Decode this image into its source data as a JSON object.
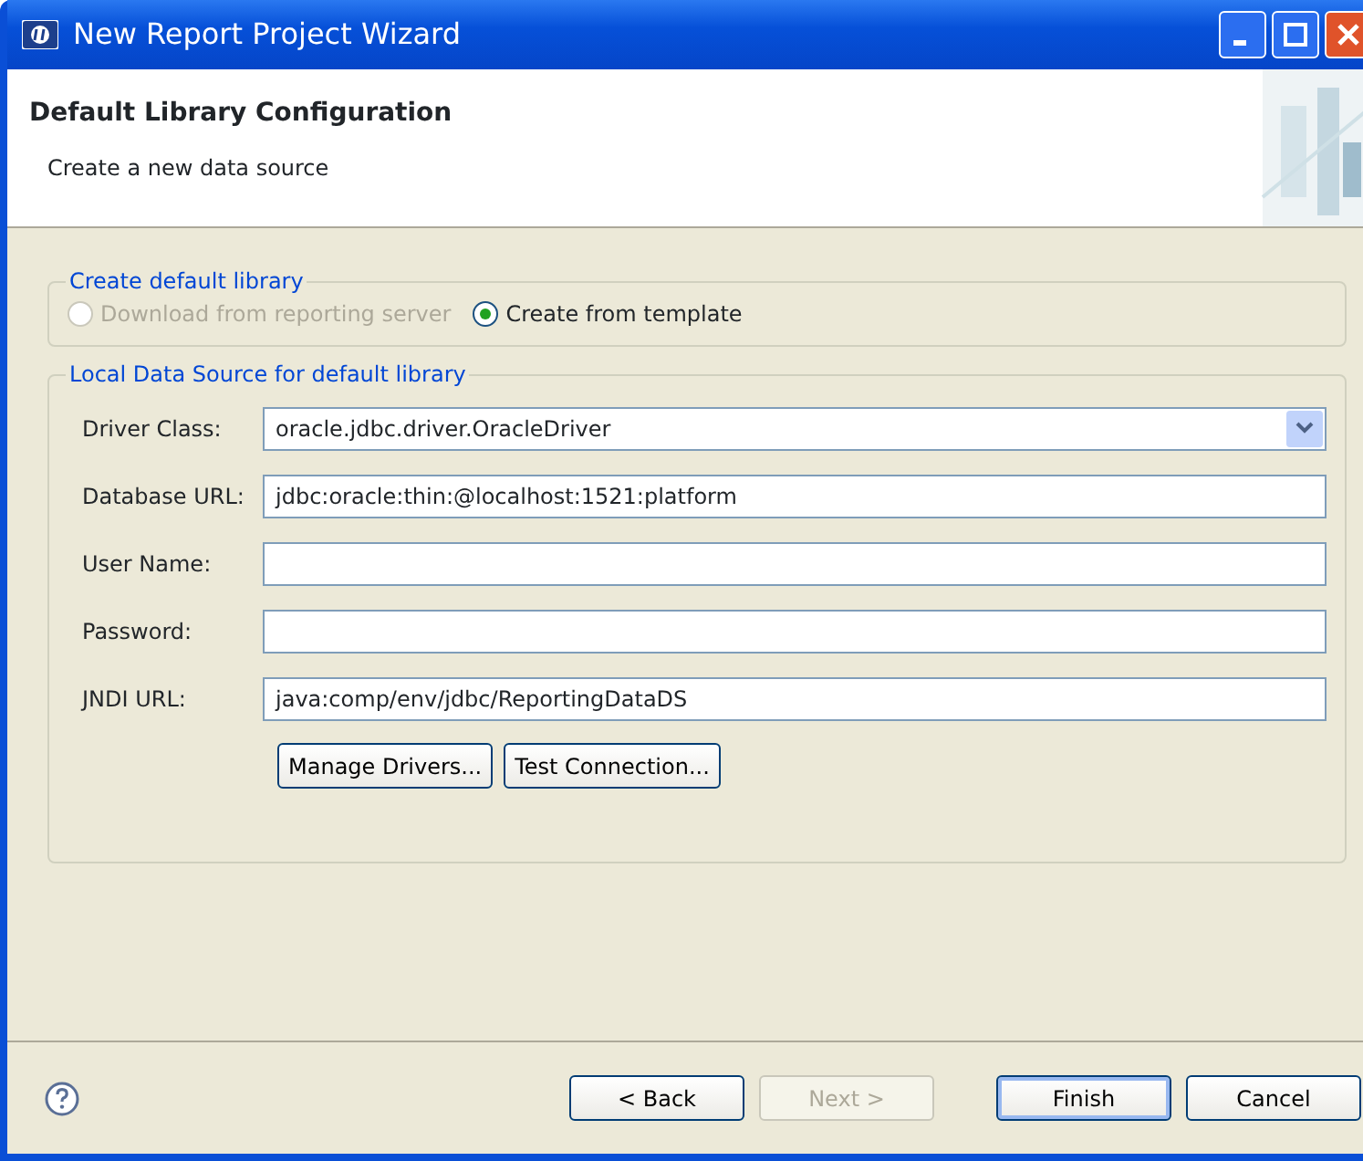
{
  "window": {
    "title": "New Report Project Wizard"
  },
  "header": {
    "title": "Default Library Configuration",
    "subtitle": "Create a new data source"
  },
  "library_group": {
    "title": "Create default library",
    "options": [
      {
        "label": "Download from reporting server",
        "selected": false,
        "disabled": true
      },
      {
        "label": "Create from template",
        "selected": true,
        "disabled": false
      }
    ]
  },
  "data_source_group": {
    "title": "Local Data Source for default library",
    "fields": [
      {
        "kind": "combo",
        "label": "Driver Class:",
        "value": "oracle.jdbc.driver.OracleDriver"
      },
      {
        "kind": "text",
        "label": "Database URL:",
        "value": "jdbc:oracle:thin:@localhost:1521:platform"
      },
      {
        "kind": "text",
        "label": "User Name:"
      },
      {
        "kind": "text",
        "label": "Password:"
      },
      {
        "kind": "text",
        "label": "JNDI URL:",
        "value": "java:comp/env/jdbc/ReportingDataDS"
      }
    ],
    "buttons": [
      "Manage Drivers...",
      "Test Connection..."
    ]
  },
  "footer_buttons": [
    {
      "label": "< Back",
      "disabled": false,
      "default": false
    },
    {
      "label": "Next >",
      "disabled": true,
      "default": false
    },
    {
      "label": "Finish",
      "disabled": false,
      "default": true
    },
    {
      "label": "Cancel",
      "disabled": false,
      "default": false
    }
  ]
}
